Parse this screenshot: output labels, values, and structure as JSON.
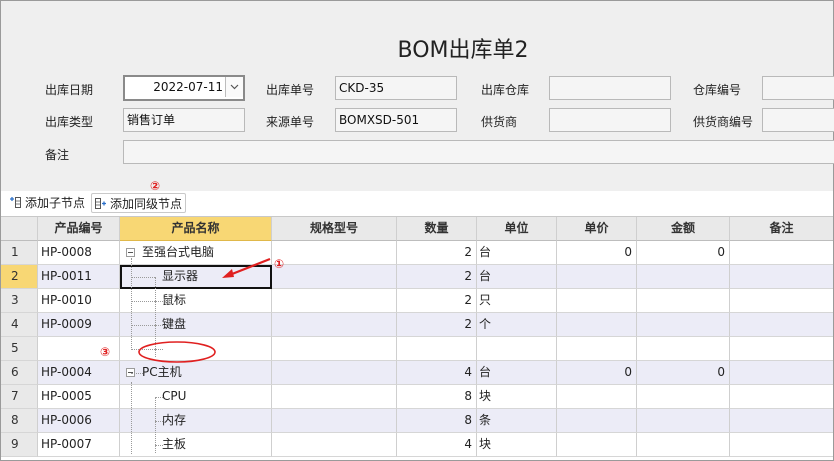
{
  "form": {
    "title": "BOM出库单2",
    "fields": {
      "out_date": {
        "label": "出库日期",
        "value": "2022-07-11"
      },
      "out_no": {
        "label": "出库单号",
        "value": "CKD-35"
      },
      "warehouse": {
        "label": "出库仓库",
        "value": ""
      },
      "warehouse_code": {
        "label": "仓库编号",
        "value": ""
      },
      "out_type": {
        "label": "出库类型",
        "value": "销售订单"
      },
      "source_no": {
        "label": "来源单号",
        "value": "BOMXSD-501"
      },
      "supplier": {
        "label": "供货商",
        "value": ""
      },
      "supplier_code": {
        "label": "供货商编号",
        "value": ""
      },
      "remark": {
        "label": "备注",
        "value": ""
      }
    }
  },
  "toolbar": {
    "add_child": "添加子节点",
    "add_sibling": "添加同级节点"
  },
  "annotations": {
    "one": "①",
    "two": "②",
    "three": "③"
  },
  "grid": {
    "columns": [
      "产品编号",
      "产品名称",
      "规格型号",
      "数量",
      "单位",
      "单价",
      "金额",
      "备注"
    ],
    "rows": [
      {
        "n": "1",
        "code": "HP-0008",
        "name": "至强台式电脑",
        "qty": "2",
        "unit": "台",
        "price": "0",
        "amount": "0"
      },
      {
        "n": "2",
        "code": "HP-0011",
        "name": "显示器",
        "qty": "2",
        "unit": "台",
        "price": "",
        "amount": ""
      },
      {
        "n": "3",
        "code": "HP-0010",
        "name": "鼠标",
        "qty": "2",
        "unit": "只",
        "price": "",
        "amount": ""
      },
      {
        "n": "4",
        "code": "HP-0009",
        "name": "键盘",
        "qty": "2",
        "unit": "个",
        "price": "",
        "amount": ""
      },
      {
        "n": "5",
        "code": "",
        "name": "",
        "qty": "",
        "unit": "",
        "price": "",
        "amount": ""
      },
      {
        "n": "6",
        "code": "HP-0004",
        "name": "PC主机",
        "qty": "4",
        "unit": "台",
        "price": "0",
        "amount": "0"
      },
      {
        "n": "7",
        "code": "HP-0005",
        "name": "CPU",
        "qty": "8",
        "unit": "块",
        "price": "",
        "amount": ""
      },
      {
        "n": "8",
        "code": "HP-0006",
        "name": "内存",
        "qty": "8",
        "unit": "条",
        "price": "",
        "amount": ""
      },
      {
        "n": "9",
        "code": "HP-0007",
        "name": "主板",
        "qty": "4",
        "unit": "块",
        "price": "",
        "amount": ""
      }
    ]
  }
}
